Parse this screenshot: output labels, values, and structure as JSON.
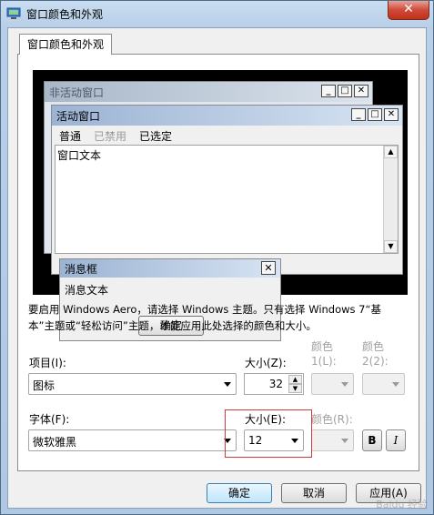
{
  "window": {
    "title": "窗口颜色和外观",
    "close_label": "✕"
  },
  "tab": {
    "label": "窗口颜色和外观"
  },
  "preview": {
    "inactive_title": "非活动窗口",
    "active_title": "活动窗口",
    "menu_normal": "普通",
    "menu_disabled": "已禁用",
    "menu_selected": "已选定",
    "window_text": "窗口文本",
    "msgbox_title": "消息框",
    "msgbox_text": "消息文本",
    "ok_label": "确定"
  },
  "info_text": "要启用 Windows Aero，请选择 Windows 主题。只有选择 Windows 7“基本”主题或“轻松访问”主题，才能应用此处选择的颜色和大小。",
  "item": {
    "label": "项目(I):",
    "value": "图标",
    "size_label": "大小(Z):",
    "size_value": "32",
    "color1_label": "颜色",
    "color1_sub": "1(L):",
    "color2_label": "颜色",
    "color2_sub": "2(2):"
  },
  "font": {
    "label": "字体(F):",
    "value": "微软雅黑",
    "size_label": "大小(E):",
    "size_value": "12",
    "color_label": "颜色(R):",
    "bold_label": "B",
    "italic_label": "I"
  },
  "buttons": {
    "ok": "确定",
    "cancel": "取消",
    "apply": "应用(A)"
  },
  "watermark": "Baidu 经验",
  "colors": {
    "highlight_box": "#d23b3b",
    "title_gradient_start": "#9cb3d3"
  }
}
